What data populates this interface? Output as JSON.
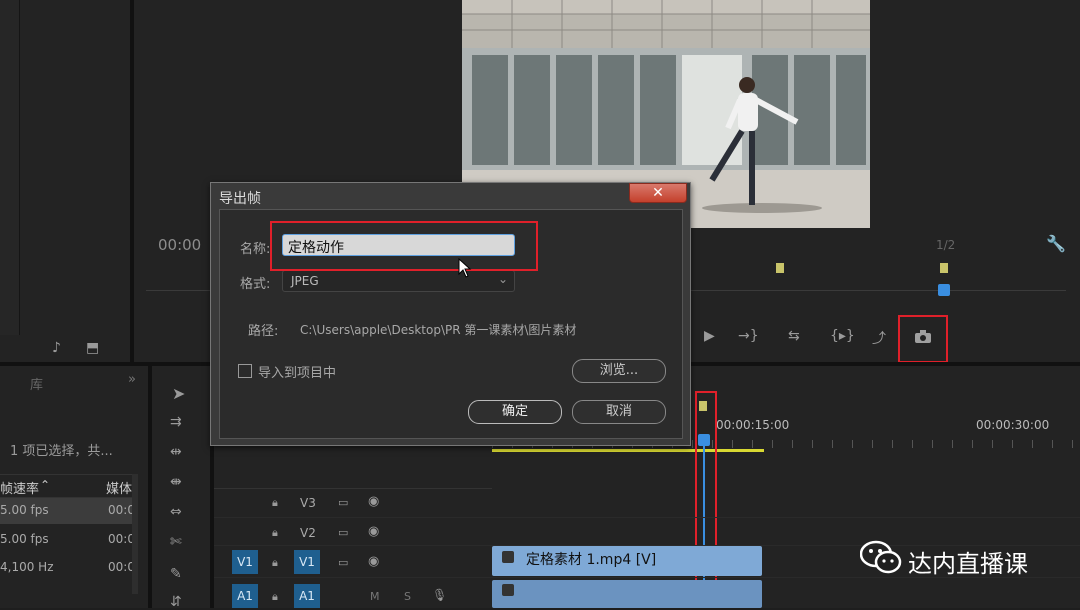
{
  "monitor": {
    "timecode_left": "00:00",
    "zoom": "1/2",
    "transport": [
      "▶",
      "→}",
      "⇆",
      "{▸}",
      "⤴",
      "camera"
    ]
  },
  "dialog": {
    "title": "导出帧",
    "close_label": "✕",
    "name_label": "名称:",
    "name_value": "定格动作",
    "format_label": "格式:",
    "format_value": "JPEG",
    "path_label": "路径:",
    "path_value": "C:\\Users\\apple\\Desktop\\PR 第一课素材\\图片素材",
    "import_label": "导入到项目中",
    "browse_label": "浏览...",
    "ok_label": "确定",
    "cancel_label": "取消"
  },
  "project": {
    "tab1": "库",
    "selection_status": "1 项已选择，共...",
    "col_rate": "帧速率",
    "col_media": "媒体",
    "rows": [
      {
        "rate": "5.00 fps",
        "media": "00:0"
      },
      {
        "rate": "5.00 fps",
        "media": "00:0"
      },
      {
        "rate": "4,100 Hz",
        "media": "00:0"
      }
    ]
  },
  "timeline": {
    "ruler_labels": [
      "00:00:15:00",
      "00:00:30:00"
    ],
    "tracks": [
      {
        "target": "",
        "name": "V3"
      },
      {
        "target": "",
        "name": "V2"
      },
      {
        "target": "V1",
        "name": "V1"
      },
      {
        "target": "A1",
        "name": "A1"
      }
    ],
    "clip_label": "定格素材 1.mp4 [V]",
    "audio_track_icons": [
      "M",
      "S"
    ]
  },
  "watermark": {
    "text": "达内直播课"
  },
  "colors": {
    "highlight_red": "#e0202a",
    "playhead_blue": "#3a8ee0",
    "clip_blue": "#7fa9d6",
    "track_target_blue": "#1f5f8f"
  }
}
